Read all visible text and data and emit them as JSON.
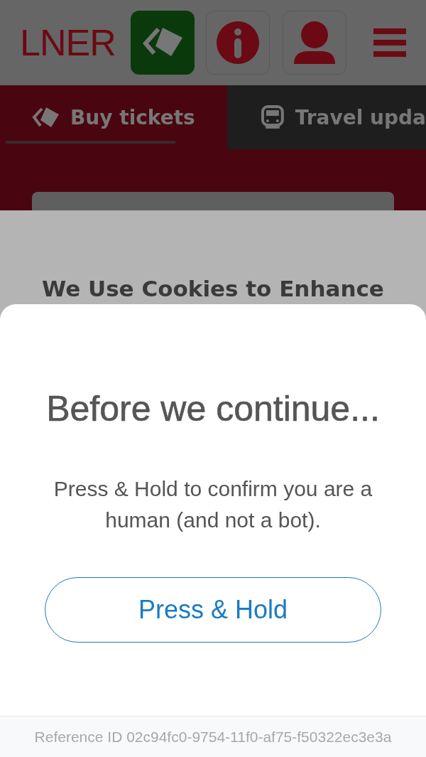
{
  "header": {
    "logo": "LNER"
  },
  "tabs": [
    {
      "label": "Buy tickets",
      "selected": true
    },
    {
      "label": "Travel upda",
      "selected": false
    }
  ],
  "cookie_banner": {
    "heading": "We Use Cookies to Enhance"
  },
  "dialog": {
    "title": "Before we continue...",
    "message": "Press & Hold to confirm you are a human (and not a bot).",
    "button": "Press & Hold",
    "reference": "Reference ID 02c94fc0-9754-11f0-af75-f50322ec3e3a"
  }
}
